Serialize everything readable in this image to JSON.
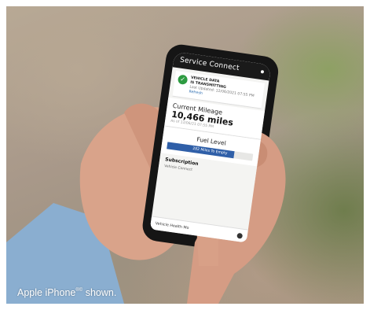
{
  "app": {
    "title": "Service Connect"
  },
  "vehicle_data": {
    "line1": "VEHICLE DATA",
    "line2": "IS TRANSMITTING",
    "updated": "Last Updated: 12/06/2021 07:55 PM",
    "refresh_label": "Refresh"
  },
  "mileage": {
    "label": "Current Mileage",
    "value": "10,466 miles",
    "sub": "As of 12/06/21 07:55 PM"
  },
  "fuel": {
    "label": "Fuel Level",
    "range_text": "282 Miles To Empty",
    "level_fraction": 0.78
  },
  "subscription": {
    "label": "Subscription",
    "item": "Vehicle Connect"
  },
  "bottom_nav": {
    "tab1": "Vehicle Health Mo",
    "icon": "circle-icon"
  },
  "caption": {
    "text": "Apple iPhone",
    "sup": "®©",
    "suffix": " shown."
  },
  "colors": {
    "status_ok": "#2e9b41",
    "fuel_fill": "#2f5fa8",
    "header_bg": "#1a1a1a"
  }
}
